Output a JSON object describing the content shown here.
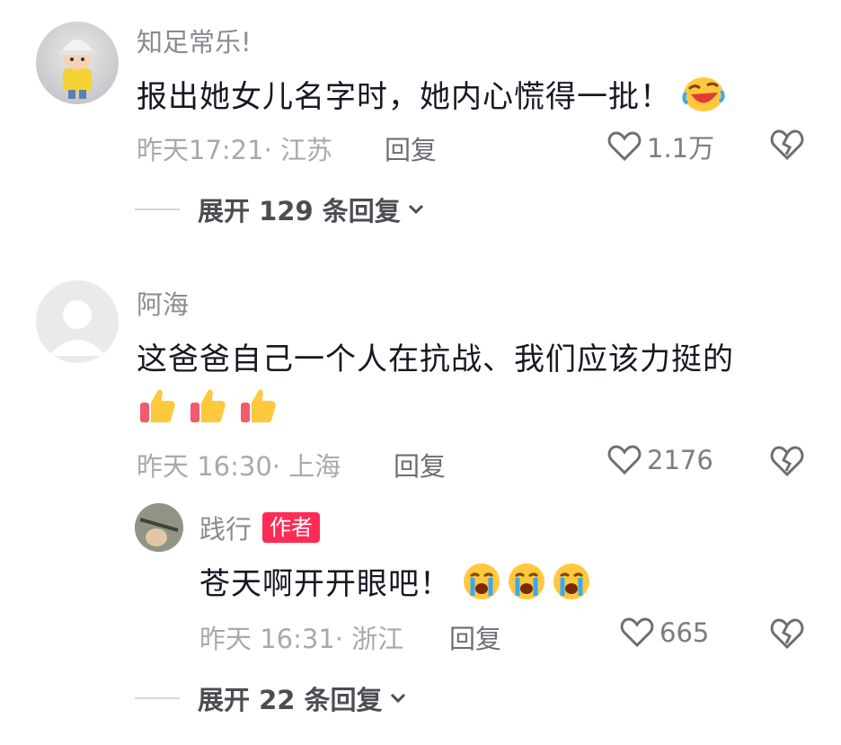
{
  "comments": [
    {
      "username": "知足常乐!",
      "text": "报出她女儿名字时，她内心慌得一批！",
      "emoji_icon": "rolling-laughing-emoji",
      "meta": "昨天17:21· 江苏",
      "reply_label": "回复",
      "likes": "1.1万",
      "expand_label": "展开 129 条回复"
    },
    {
      "username": "阿海",
      "text": "这爸爸自己一个人在抗战、我们应该力挺的",
      "emoji_icon": "thumbs-up-emoji",
      "meta": "昨天 16:30· 上海",
      "reply_label": "回复",
      "likes": "2176"
    }
  ],
  "reply": {
    "username": "践行",
    "badge": "作者",
    "text": "苍天啊开开眼吧！",
    "emoji_icon": "crying-emoji",
    "meta": "昨天 16:31· 浙江",
    "reply_label": "回复",
    "likes": "665",
    "expand_label": "展开 22 条回复"
  },
  "colors": {
    "badge": "#fe2c55",
    "text": "#161823",
    "meta": "#a8a9ad"
  }
}
